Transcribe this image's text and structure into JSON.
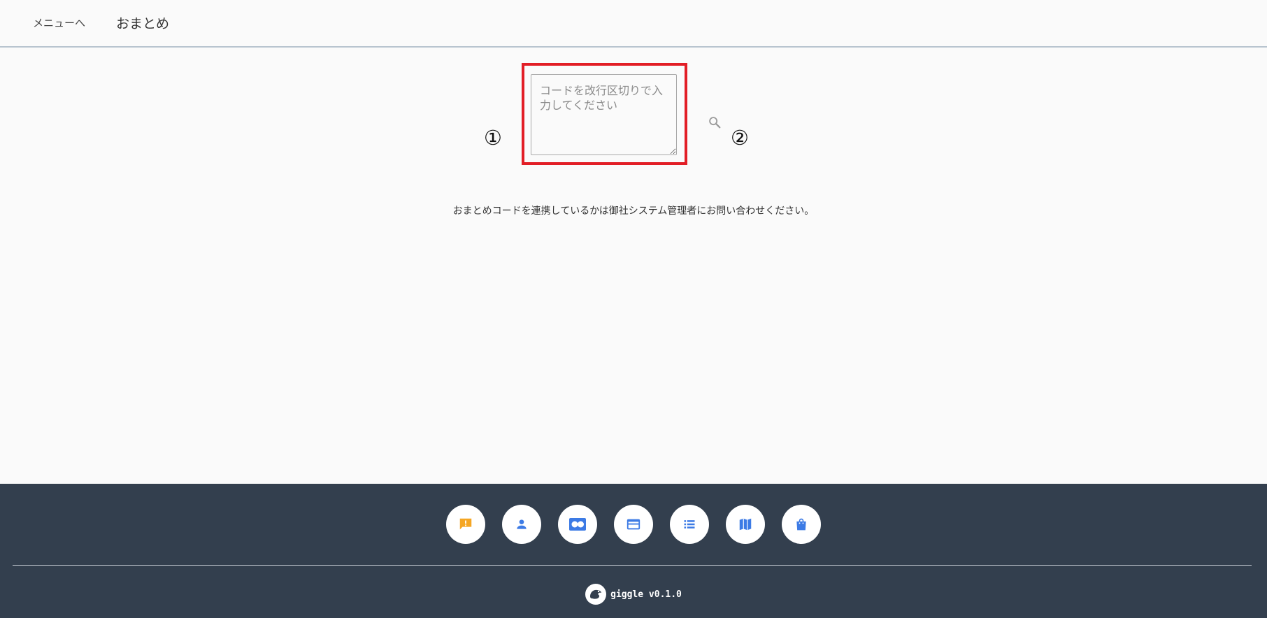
{
  "header": {
    "back_label": "メニューへ",
    "title": "おまとめ"
  },
  "main": {
    "code_input": {
      "value": "",
      "placeholder": "コードを改行区切りで入力してください"
    },
    "markers": [
      "①",
      "②"
    ],
    "search_icon": "search-icon",
    "notice": "おまとめコードを連携しているかは御社システム管理者にお問い合わせください。"
  },
  "footer": {
    "nav_buttons": [
      {
        "icon": "feedback-icon",
        "color": "#f5a623"
      },
      {
        "icon": "person-icon",
        "color": "#3d7be5"
      },
      {
        "icon": "id-card-icon",
        "color": "#3d7be5"
      },
      {
        "icon": "credit-card-icon",
        "color": "#3d7be5"
      },
      {
        "icon": "list-icon",
        "color": "#3d7be5"
      },
      {
        "icon": "map-icon",
        "color": "#3d7be5"
      },
      {
        "icon": "shopping-bag-icon",
        "color": "#3d7be5"
      }
    ],
    "brand_text": "giggle v0.1.0"
  },
  "colors": {
    "highlight": "#e21e26",
    "footer_bg": "#333f4e",
    "accent_blue": "#3d7be5",
    "accent_amber": "#f5a623"
  }
}
